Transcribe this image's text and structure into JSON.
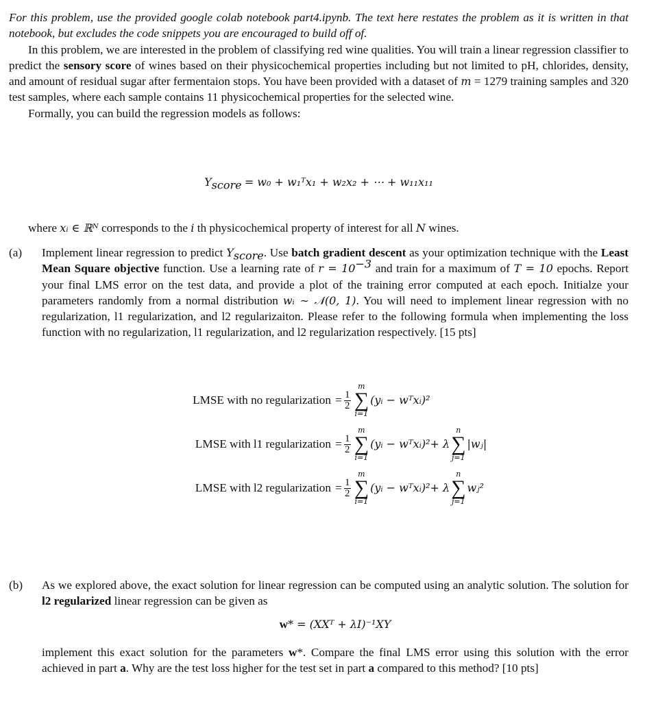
{
  "intro": {
    "text": "For this problem, use the provided google colab notebook part4.ipynb. The text here restates the problem as it is written in that notebook, but excludes the code snippets you are encouraged to build off of."
  },
  "problem": {
    "p1_a": "In this problem, we are interested in the problem of classifying red wine qualities. You will train a linear regression classifier to predict the ",
    "p1_bold": "sensory score",
    "p1_b": " of wines based on their physicochemical properties including but not limited to pH, chlorides, density, and amount of residual sugar after fermentaion stops. You have been provided with a dataset of ",
    "p1_m": "m",
    "p1_c": " = 1279 training samples and 320 test samples, where each sample contains 11 physicochemical properties for the selected wine.",
    "p2": "Formally, you can build the regression models as follows:"
  },
  "model_equation": {
    "lhs": "Y",
    "lhs_sub": "score",
    "rhs": "= w₀ + w₁ᵀx₁ + w₂x₂ + ⋯ + w₁₁x₁₁"
  },
  "where_text": {
    "a": "where ",
    "var": "xᵢ ∈ ℝᴺ",
    "b": " corresponds to the ",
    "i": "i",
    "c": " th physicochemical property of interest for all ",
    "N": "N",
    "d": " wines."
  },
  "part_a": {
    "label": "(a)",
    "t1": "Implement linear regression to predict ",
    "y": "Y",
    "ysub": "score",
    "t2": ". Use ",
    "b1": "batch gradient descent",
    "t3": " as your optimization technique with the ",
    "b2": "Least Mean Square objective",
    "t4": " function. Use a learning rate of ",
    "lr": "r = 10",
    "lr_exp": "−3",
    "t5": " and train for a maximum of ",
    "T": "T = 10",
    "t6": " epochs. Report your final LMS error on the test data, and provide a plot of the training error computed at each epoch. Initialze your parameters randomly from a normal distribution ",
    "dist": "wᵢ ∼ 𝒩(0, 1)",
    "t7": ". You will need to implement linear regression with no regularization, l1 regularization, and l2 regularizaiton. Please refer to the following formula when implementing the loss function with no regularization, l1 regularization, and l2 regularization respectively. [15 pts]"
  },
  "losses": [
    {
      "name": "LMSE with no regularization",
      "eq": "=",
      "frac_num": "1",
      "frac_den": "2",
      "sum_top": "m",
      "sum_bot": "i=1",
      "body": "(yᵢ − wᵀxᵢ)²",
      "reg": "",
      "reg_sum_top": "",
      "reg_sum_bot": "",
      "reg_body": ""
    },
    {
      "name": "LMSE with l1 regularization",
      "eq": "=",
      "frac_num": "1",
      "frac_den": "2",
      "sum_top": "m",
      "sum_bot": "i=1",
      "body": "(yᵢ − wᵀxᵢ)²",
      "reg": " + λ",
      "reg_sum_top": "n",
      "reg_sum_bot": "j=1",
      "reg_body": "|wⱼ|"
    },
    {
      "name": "LMSE with l2 regularization",
      "eq": "=",
      "frac_num": "1",
      "frac_den": "2",
      "sum_top": "m",
      "sum_bot": "i=1",
      "body": "(yᵢ − wᵀxᵢ)²",
      "reg": " + λ",
      "reg_sum_top": "n",
      "reg_sum_bot": "j=1",
      "reg_body": "wⱼ²"
    }
  ],
  "part_b": {
    "label": "(b)",
    "t1": "As we explored above, the exact solution for linear regression can be computed using an analytic solution. The solution for ",
    "b1": "l2 regularized",
    "t2": " linear regression can be given as",
    "eq_w": "w",
    "eq_rest": "* = (XXᵀ + λI)⁻¹XY",
    "t3": "implement this exact solution for the parameters ",
    "w": "w",
    "t4": "*. Compare the final LMS error using this solution with the error achieved in part ",
    "a1": "a",
    "t5": ". Why are the test loss higher for the test set in part ",
    "a2": "a",
    "t6": " compared to this method? [10 pts]"
  }
}
